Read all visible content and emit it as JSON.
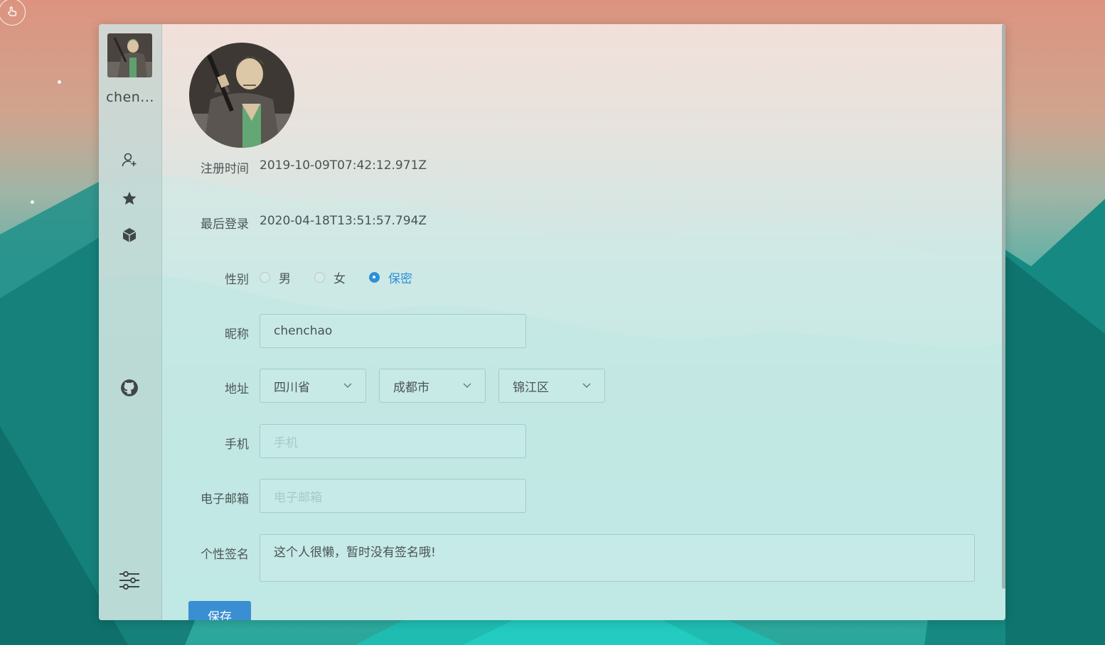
{
  "sidebar": {
    "username": "chen...",
    "items": [
      {
        "icon": "user-add-icon"
      },
      {
        "icon": "star-icon"
      },
      {
        "icon": "cube-icon"
      },
      {
        "icon": "github-icon"
      },
      {
        "icon": "sliders-icon"
      }
    ]
  },
  "profile": {
    "register_label": "注册时间",
    "register_value": "2019-10-09T07:42:12.971Z",
    "last_login_label": "最后登录",
    "last_login_value": "2020-04-18T13:51:57.794Z",
    "gender_label": "性别",
    "gender_options": [
      "男",
      "女",
      "保密"
    ],
    "gender_selected": "保密",
    "nickname_label": "昵称",
    "nickname_value": "chenchao",
    "address_label": "地址",
    "province": "四川省",
    "city": "成都市",
    "district": "锦江区",
    "phone_label": "手机",
    "phone_placeholder": "手机",
    "email_label": "电子邮箱",
    "email_placeholder": "电子邮箱",
    "signature_label": "个性签名",
    "signature_value": "这个人很懒，暂时没有签名哦!",
    "save_label": "保存"
  },
  "colors": {
    "accent": "#2d8fd8",
    "button": "#3a8fd3"
  }
}
